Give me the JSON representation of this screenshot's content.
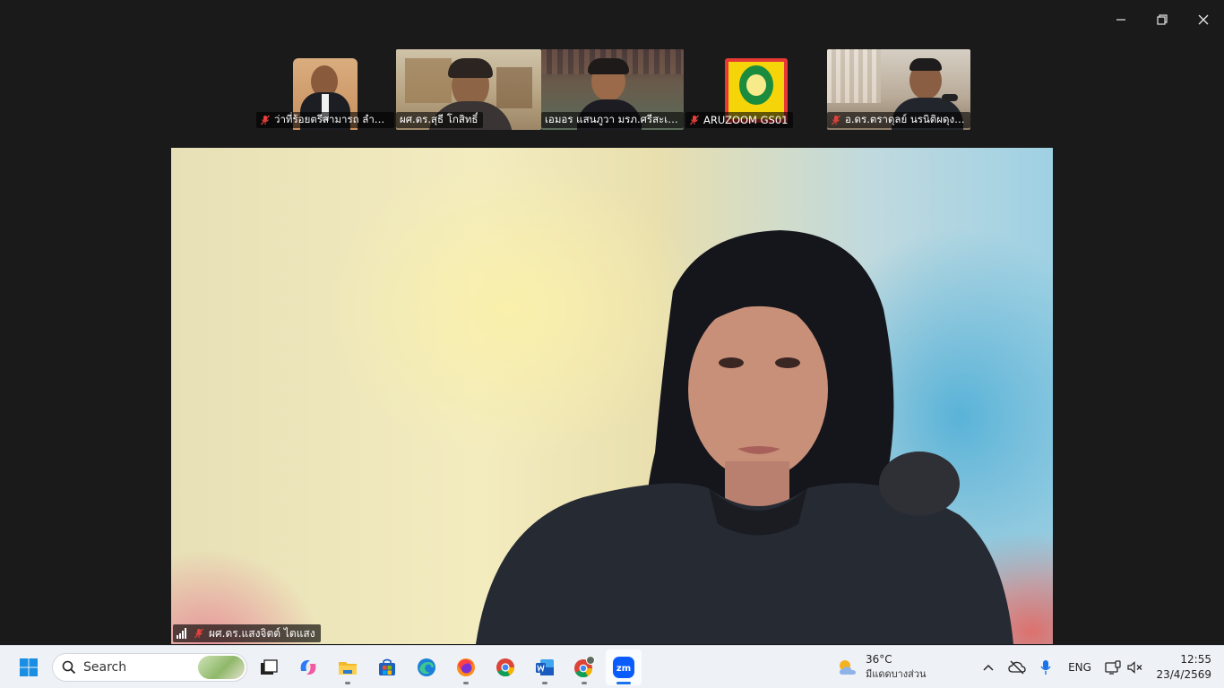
{
  "colors": {
    "background": "#1a1a1a",
    "active_speaker_outline": "#23d18b",
    "taskbar": "#eef1f6",
    "accent": "#1a73e8"
  },
  "participants": [
    {
      "name": "ว่าที่ร้อยตรีสามารถ ลำโย...",
      "muted": true,
      "active": false
    },
    {
      "name": "ผศ.ดร.สุธี โกสิทธิ์",
      "muted": false,
      "active": true
    },
    {
      "name": "เอมอร แสนภูวา มรภ.ศรีสะเกษ",
      "muted": false,
      "active": false
    },
    {
      "name": "ARUZOOM GS01",
      "muted": true,
      "active": false
    },
    {
      "name": "อ.ดร.ตราดุลย์ นรนิติผดุงก...",
      "muted": true,
      "active": false
    }
  ],
  "main_speaker": {
    "name": "ผศ.ดร.แสงจิตต์ ไตแสง",
    "muted": true
  },
  "taskbar": {
    "search_label": "Search",
    "apps": [
      {
        "name": "start",
        "icon": "windows-logo-icon",
        "running": false
      },
      {
        "name": "task-view",
        "icon": "task-view-icon",
        "running": false
      },
      {
        "name": "copilot",
        "icon": "copilot-icon",
        "running": false
      },
      {
        "name": "file-explorer",
        "icon": "folder-icon",
        "running": true
      },
      {
        "name": "microsoft-store",
        "icon": "store-icon",
        "running": false
      },
      {
        "name": "edge",
        "icon": "edge-icon",
        "running": false
      },
      {
        "name": "firefox",
        "icon": "firefox-icon",
        "running": true
      },
      {
        "name": "chrome",
        "icon": "chrome-icon",
        "running": false
      },
      {
        "name": "word",
        "icon": "word-icon",
        "running": true
      },
      {
        "name": "chrome-profile",
        "icon": "chrome-profile-icon",
        "running": true
      },
      {
        "name": "zoom",
        "icon": "zoom-icon",
        "running": true
      }
    ],
    "zoom_label": "zm",
    "weather": {
      "temp": "36°C",
      "condition": "มีแดดบางส่วน"
    },
    "language": "ENG",
    "time": "12:55",
    "date": "23/4/2569"
  }
}
